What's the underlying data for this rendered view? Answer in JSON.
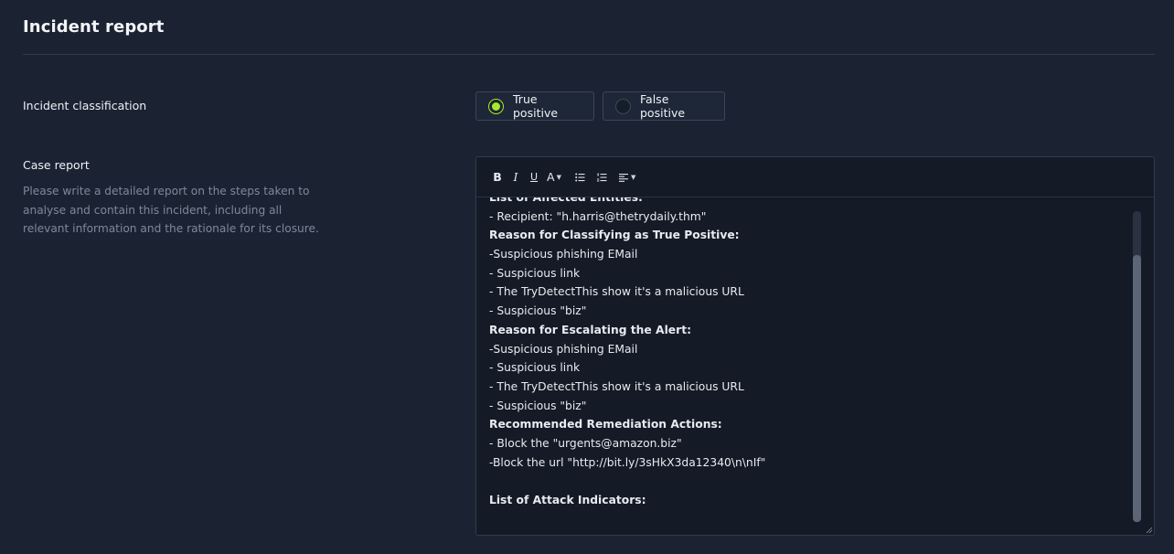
{
  "header": {
    "title": "Incident report"
  },
  "classification": {
    "label": "Incident classification",
    "options": [
      {
        "label": "True positive",
        "checked": true
      },
      {
        "label": "False positive",
        "checked": false
      }
    ],
    "accent_color": "#a3ea2a"
  },
  "case_report": {
    "label": "Case report",
    "help_text": "Please write a detailed report on the steps taken to analyse and contain this incident, including all relevant information and the rationale for its closure."
  },
  "editor": {
    "toolbar": {
      "bold": "B",
      "italic": "I",
      "underline": "U",
      "text_color": "A",
      "bulleted_list_icon": "bulleted-list-icon",
      "numbered_list_icon": "numbered-list-icon",
      "align_icon": "align-left-icon"
    },
    "lines": [
      {
        "text": "List of Affected Entities:",
        "bold": true
      },
      {
        "text": "- Recipient: \"h.harris@thetrydaily.thm\"",
        "bold": false
      },
      {
        "text": "Reason for Classifying as True Positive:",
        "bold": true
      },
      {
        "text": "-Suspicious phishing EMail",
        "bold": false
      },
      {
        "text": "- Suspicious link",
        "bold": false
      },
      {
        "text": "- The TryDetectThis show it's a malicious URL",
        "bold": false
      },
      {
        "text": "- Suspicious \"biz\"",
        "bold": false
      },
      {
        "text": "Reason for Escalating the Alert:",
        "bold": true
      },
      {
        "text": "-Suspicious phishing EMail",
        "bold": false
      },
      {
        "text": "- Suspicious link",
        "bold": false
      },
      {
        "text": "- The TryDetectThis show it's a malicious URL",
        "bold": false
      },
      {
        "text": "- Suspicious \"biz\"",
        "bold": false
      },
      {
        "text": "Recommended Remediation Actions:",
        "bold": true
      },
      {
        "text": "- Block the \"urgents@amazon.biz\"",
        "bold": false
      },
      {
        "text": "-Block the url \"http://bit.ly/3sHkX3da12340\\n\\nIf\"",
        "bold": false
      },
      {
        "text": "",
        "bold": false
      },
      {
        "text": "List of Attack Indicators:",
        "bold": true
      }
    ]
  }
}
